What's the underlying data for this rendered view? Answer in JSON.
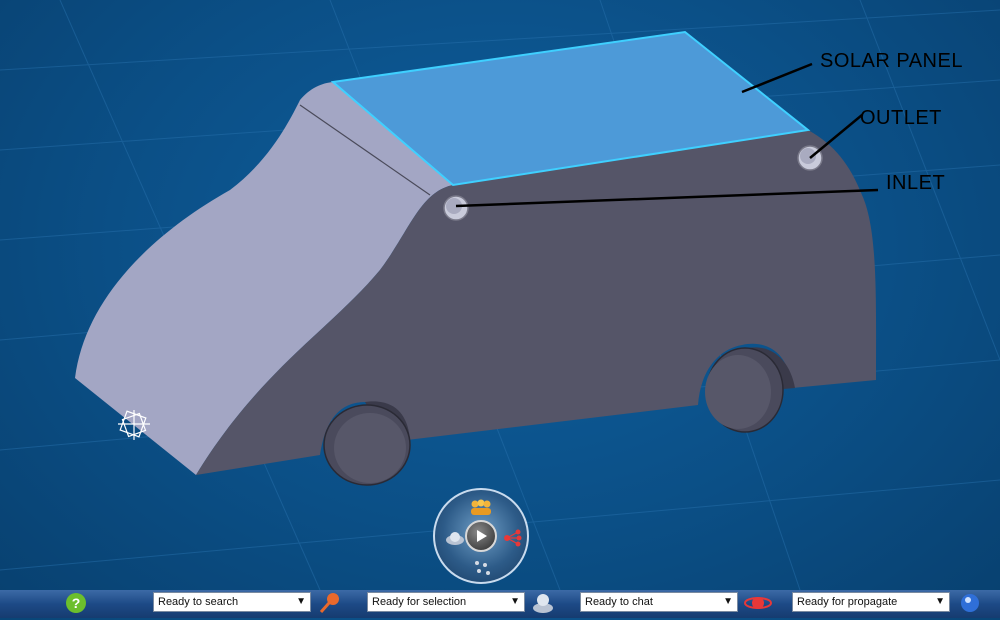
{
  "annotations": {
    "solar_panel": "SOLAR PANEL",
    "outlet": "OUTLET",
    "inlet": "INLET"
  },
  "compass": {
    "icons": [
      "people-icon",
      "globe-icon",
      "play-icon",
      "network-icon",
      "dots-icon"
    ]
  },
  "taskbar": {
    "search_status": "Ready to search",
    "selection_status": "Ready for selection",
    "chat_status": "Ready to chat",
    "propagate_status": "Ready for propagate",
    "icons": [
      "help-icon",
      "search-key-icon",
      "chat-icon",
      "propagate-icon",
      "info-icon"
    ]
  },
  "colors": {
    "background": "#0b4f86",
    "car_body": "#555568",
    "car_front": "#a3a6c4",
    "solar_panel": "#4d9ad8",
    "panel_edge": "#3fd0ff"
  }
}
